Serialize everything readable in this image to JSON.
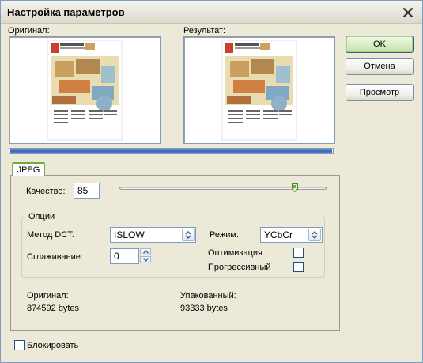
{
  "window": {
    "title": "Настройка параметров"
  },
  "preview": {
    "original_label": "Оригинал:",
    "result_label": "Результат:"
  },
  "buttons": {
    "ok": "OK",
    "cancel": "Отмена",
    "preview": "Просмотр"
  },
  "tab": {
    "label": "JPEG"
  },
  "quality": {
    "label": "Качество:",
    "value": "85"
  },
  "options": {
    "legend": "Опции",
    "dct_label": "Метод DCT:",
    "dct_value": "ISLOW",
    "mode_label": "Режим:",
    "mode_value": "YCbCr",
    "smoothing_label": "Сглаживание:",
    "smoothing_value": "0",
    "optimize_label": "Оптимизация",
    "optimize_checked": false,
    "progressive_label": "Прогрессивный",
    "progressive_checked": false
  },
  "sizes": {
    "original_label": "Оригинал:",
    "original_value": "874592 bytes",
    "packed_label": "Упакованный:",
    "packed_value": "93333 bytes"
  },
  "lock": {
    "label": "Блокировать",
    "checked": false
  },
  "progress": {
    "fraction": 1.0
  },
  "colors": {
    "accent": "#3a5fb8",
    "default_button": "#c0dca4",
    "tab_accent": "#6cae3c"
  }
}
